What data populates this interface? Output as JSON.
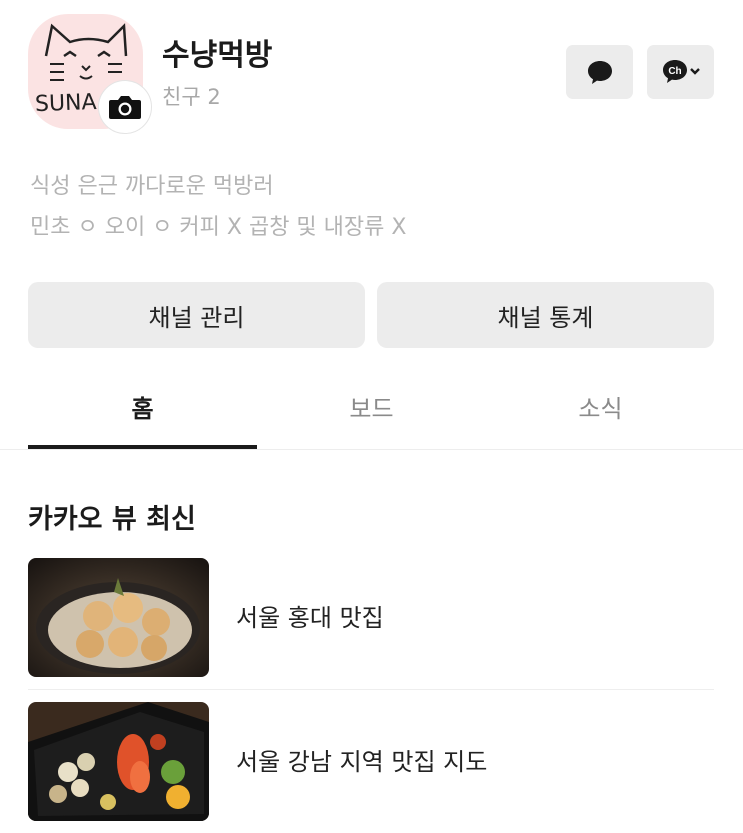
{
  "profile": {
    "name": "수냥먹방",
    "friends": "친구 2",
    "avatar_text": "SUNA",
    "avatar_bg": "#fbe3e3"
  },
  "header_buttons": {
    "chat_icon": "chat-bubble-icon",
    "channel_icon": "channel-chat-icon",
    "channel_badge": "Ch"
  },
  "bio": {
    "line1": "식성 은근 까다로운 먹방러",
    "line2": "민초 ㅇ 오이 ㅇ 커피 X 곱창 및 내장류 X"
  },
  "actions": {
    "manage": "채널 관리",
    "stats": "채널 통계"
  },
  "tabs": [
    {
      "label": "홈",
      "active": true
    },
    {
      "label": "보드",
      "active": false
    },
    {
      "label": "소식",
      "active": false
    }
  ],
  "section": {
    "title": "카카오 뷰 최신"
  },
  "items": [
    {
      "title": "서울 홍대 맛집"
    },
    {
      "title": "서울 강남 지역 맛집 지도"
    }
  ]
}
